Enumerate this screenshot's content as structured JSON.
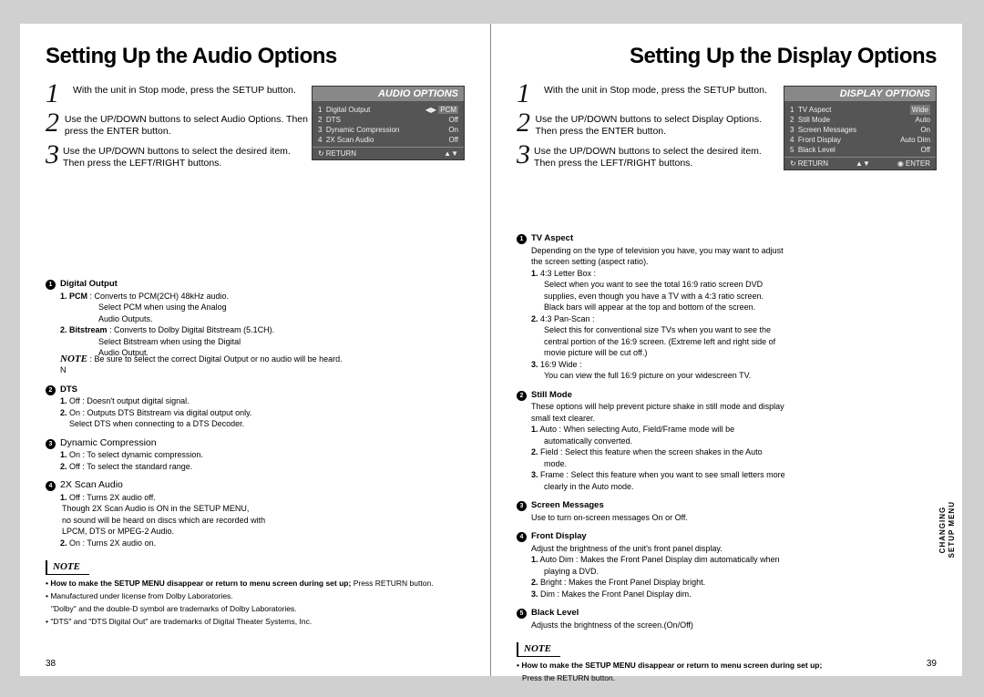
{
  "left": {
    "title": "Setting Up the Audio Options",
    "steps": [
      "With the unit in Stop mode, press the SETUP button.",
      "Use the UP/DOWN buttons to select Audio Options. Then press the ENTER button.",
      "Use the UP/DOWN buttons to select the desired item. Then press the LEFT/RIGHT buttons."
    ],
    "osd": {
      "title": "AUDIO OPTIONS",
      "rows": [
        {
          "n": "1",
          "label": "Digital Output",
          "val": "PCM",
          "sel": true
        },
        {
          "n": "2",
          "label": "DTS",
          "val": "Off"
        },
        {
          "n": "3",
          "label": "Dynamic Compression",
          "val": "On"
        },
        {
          "n": "4",
          "label": "2X Scan Audio",
          "val": "Off"
        }
      ],
      "footerL": "RETURN",
      "footerR": ""
    },
    "items": [
      {
        "head": "Digital Output",
        "lines": [
          {
            "lead": "1. PCM",
            "text": " : Converts to PCM(2CH) 48kHz audio."
          },
          {
            "text": "Select PCM when using the Analog"
          },
          {
            "text": "Audio Outputs."
          },
          {
            "lead": "2. Bitstream",
            "text": " : Converts to Dolby Digital Bitstream (5.1CH)."
          },
          {
            "text": "Select Bitstream when using the Digital"
          },
          {
            "text": "Audio Output."
          }
        ],
        "note": " : Be sure to select the correct Digital Output or no audio will be heard.",
        "noteLabel": "NOTE",
        "trailN": "N"
      },
      {
        "head": "DTS",
        "lines": [
          {
            "lead": "1.",
            "text": " Off : Doesn't output digital signal."
          },
          {
            "lead": "2.",
            "text": " On : Outputs DTS Bitstream via digital output only."
          },
          {
            "text": "Select DTS when connecting to a DTS Decoder."
          }
        ]
      },
      {
        "head": "Dynamic Compression",
        "lines": [
          {
            "lead": "1.",
            "text": " On : To select dynamic compression."
          },
          {
            "lead": "2.",
            "text": " Off : To select the standard range."
          }
        ]
      },
      {
        "head": "2X Scan Audio",
        "lines": [
          {
            "lead": "1.",
            "text": " Off : Turns 2X audio off."
          },
          {
            "text": "Though 2X Scan Audio is ON in the SETUP MENU,"
          },
          {
            "text": "no sound will be heard on discs which are recorded with"
          },
          {
            "text": "LPCM, DTS or MPEG-2 Audio."
          },
          {
            "lead": "2.",
            "text": " On : Turns 2X audio on."
          }
        ]
      }
    ],
    "noteBox": "NOTE",
    "notes": [
      {
        "lead": "• How to make the SETUP MENU disappear or return to menu screen during set up;",
        "text": " Press RETURN button."
      },
      {
        "text": "• Manufactured under license from Dolby Laboratories."
      },
      {
        "text": "\"Dolby\" and the double-D symbol are trademarks of Dolby Laboratories."
      },
      {
        "text": "• \"DTS\" and \"DTS Digital Out\" are trademarks of Digital Theater Systems, Inc."
      }
    ],
    "page": "38"
  },
  "right": {
    "title": "Setting Up the Display Options",
    "steps": [
      "With the unit in Stop mode, press the SETUP button.",
      "Use the UP/DOWN buttons to select Display Options. Then press the ENTER button.",
      "Use the UP/DOWN buttons to select the desired item. Then press the LEFT/RIGHT buttons."
    ],
    "osd": {
      "title": "DISPLAY OPTIONS",
      "rows": [
        {
          "n": "1",
          "label": "TV Aspect",
          "val": "Wide",
          "sel": true
        },
        {
          "n": "2",
          "label": "Still Mode",
          "val": "Auto"
        },
        {
          "n": "3",
          "label": "Screen Messages",
          "val": "On"
        },
        {
          "n": "4",
          "label": "Front Display",
          "val": "Auto  Dim"
        },
        {
          "n": "5",
          "label": "Black Level",
          "val": "Off"
        }
      ],
      "footerL": "RETURN",
      "footerR": "ENTER"
    },
    "items": [
      {
        "head": "TV Aspect",
        "lines": [
          {
            "text": "Depending on the type of television you have, you may want to adjust"
          },
          {
            "text": "the screen setting (aspect ratio)."
          },
          {
            "lead": "1.",
            "text": " 4:3 Letter Box :"
          },
          {
            "text": "Select when you want to see the total 16:9 ratio screen DVD"
          },
          {
            "text": "supplies, even though you have a TV with a 4:3 ratio screen."
          },
          {
            "text": "Black bars will appear at the top and bottom of the screen."
          },
          {
            "lead": "2.",
            "text": " 4:3 Pan-Scan :"
          },
          {
            "text": "Select this for conventional size TVs when you want to see the"
          },
          {
            "text": "central portion of the 16:9 screen. (Extreme left and right side of"
          },
          {
            "text": "movie picture will be cut off.)"
          },
          {
            "lead": "3.",
            "text": " 16:9 Wide :"
          },
          {
            "text": "You can view the full 16:9 picture on your widescreen TV."
          }
        ]
      },
      {
        "head": "Still Mode",
        "lines": [
          {
            "text": "These options will help prevent picture shake in still mode and display"
          },
          {
            "text": "small text clearer."
          },
          {
            "lead": "1.",
            "text": " Auto : When selecting Auto, Field/Frame mode will be"
          },
          {
            "text": "automatically converted."
          },
          {
            "lead": "2.",
            "text": " Field : Select this feature when the screen shakes in the Auto"
          },
          {
            "text": "mode."
          },
          {
            "lead": "3.",
            "text": " Frame : Select this feature when you want to see small letters more"
          },
          {
            "text": "clearly in the Auto mode."
          }
        ]
      },
      {
        "head": "Screen Messages",
        "lines": [
          {
            "text": "Use to turn on-screen messages On or Off."
          }
        ]
      },
      {
        "head": "Front Display",
        "lines": [
          {
            "text": "Adjust the brightness of the unit's front panel display."
          },
          {
            "lead": "1.",
            "text": " Auto Dim : Makes the Front Panel Display dim automatically when"
          },
          {
            "text": "playing a DVD."
          },
          {
            "lead": "2.",
            "text": " Bright : Makes the Front Panel Display bright."
          },
          {
            "lead": "3.",
            "text": " Dim : Makes the Front Panel Display dim."
          }
        ]
      },
      {
        "head": "Black Level",
        "lines": [
          {
            "text": "Adjusts the brightness of the screen.(On/Off)"
          }
        ]
      }
    ],
    "noteBox": "NOTE",
    "notes": [
      {
        "lead": "• How to make the SETUP MENU disappear or return to menu screen during set up;",
        "text": ""
      },
      {
        "text": "Press the RETURN button."
      }
    ],
    "page": "39",
    "sideTab1": "CHANGING",
    "sideTab2": "SETUP MENU"
  }
}
